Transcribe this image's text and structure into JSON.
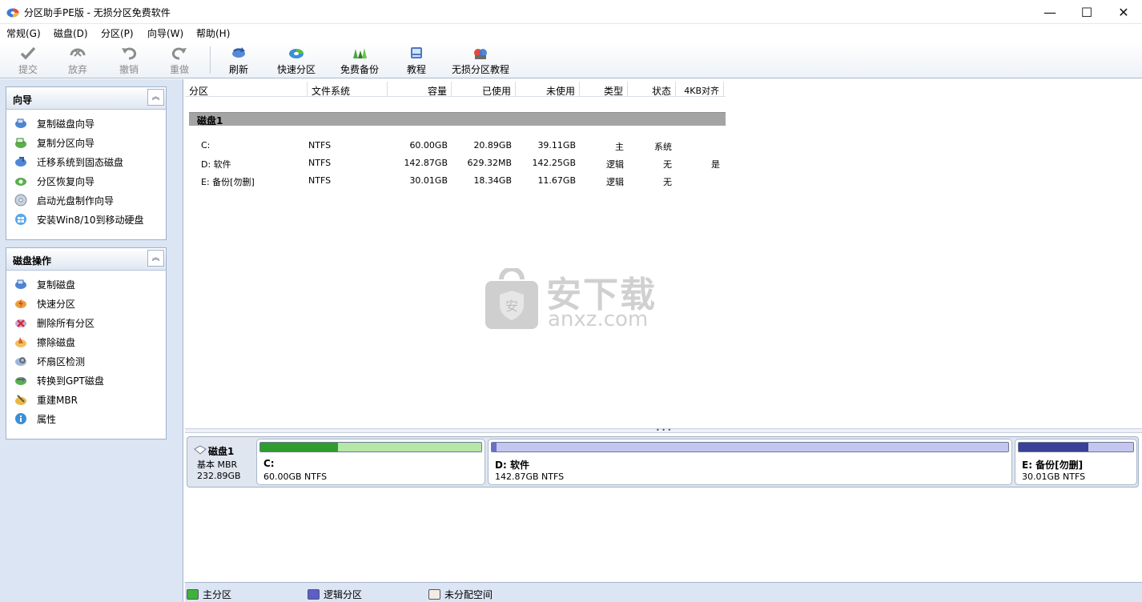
{
  "window": {
    "title": "分区助手PE版 - 无损分区免费软件",
    "min_glyph": "—",
    "max_glyph": "☐",
    "close_glyph": "✕"
  },
  "menu": [
    "常规(G)",
    "磁盘(D)",
    "分区(P)",
    "向导(W)",
    "帮助(H)"
  ],
  "toolbar": {
    "submit": "提交",
    "discard": "放弃",
    "undo": "撤销",
    "redo": "重做",
    "refresh": "刷新",
    "quick_partition": "快速分区",
    "free_backup": "免费备份",
    "tutorial": "教程",
    "lossless_tutorial": "无损分区教程"
  },
  "sidebar": {
    "wizard": {
      "title": "向导",
      "items": [
        "复制磁盘向导",
        "复制分区向导",
        "迁移系统到固态磁盘",
        "分区恢复向导",
        "启动光盘制作向导",
        "安装Win8/10到移动硬盘"
      ]
    },
    "disk_ops": {
      "title": "磁盘操作",
      "items": [
        "复制磁盘",
        "快速分区",
        "删除所有分区",
        "擦除磁盘",
        "坏扇区检测",
        "转换到GPT磁盘",
        "重建MBR",
        "属性"
      ]
    }
  },
  "table": {
    "headers": [
      "分区",
      "文件系统",
      "容量",
      "已使用",
      "未使用",
      "类型",
      "状态",
      "4KB对齐"
    ],
    "disk_label": "磁盘1",
    "rows": [
      [
        "C:",
        "NTFS",
        "60.00GB",
        "20.89GB",
        "39.11GB",
        "主",
        "系统",
        ""
      ],
      [
        "D: 软件",
        "NTFS",
        "142.87GB",
        "629.32MB",
        "142.25GB",
        "逻辑",
        "无",
        "是"
      ],
      [
        "E: 备份[勿删]",
        "NTFS",
        "30.01GB",
        "18.34GB",
        "11.67GB",
        "逻辑",
        "无",
        ""
      ]
    ]
  },
  "watermark": {
    "badge_char": "安",
    "title": "安下载",
    "sub": "anxz.com"
  },
  "diskmap": {
    "disk": {
      "name": "磁盘1",
      "type": "基本 MBR",
      "size": "232.89GB"
    },
    "partitions": [
      {
        "name": "C:",
        "info": "60.00GB NTFS",
        "used_fraction": 0.35,
        "fill_color": "#2e9c2e",
        "track_color": "#b6e6a8"
      },
      {
        "name": "D: 软件",
        "info": "142.87GB NTFS",
        "used_fraction": 0.01,
        "fill_color": "#6a6fc8",
        "track_color": "#c4c6ef"
      },
      {
        "name": "E: 备份[勿删]",
        "info": "30.01GB NTFS",
        "used_fraction": 0.61,
        "fill_color": "#3a3f98",
        "track_color": "#c4c6ef"
      }
    ]
  },
  "legend": {
    "primary": {
      "label": "主分区",
      "color": "#3cb43c"
    },
    "logical": {
      "label": "逻辑分区",
      "color": "#5b5fc7"
    },
    "unallocated": {
      "label": "未分配空间",
      "color": "#f3ece2"
    }
  }
}
